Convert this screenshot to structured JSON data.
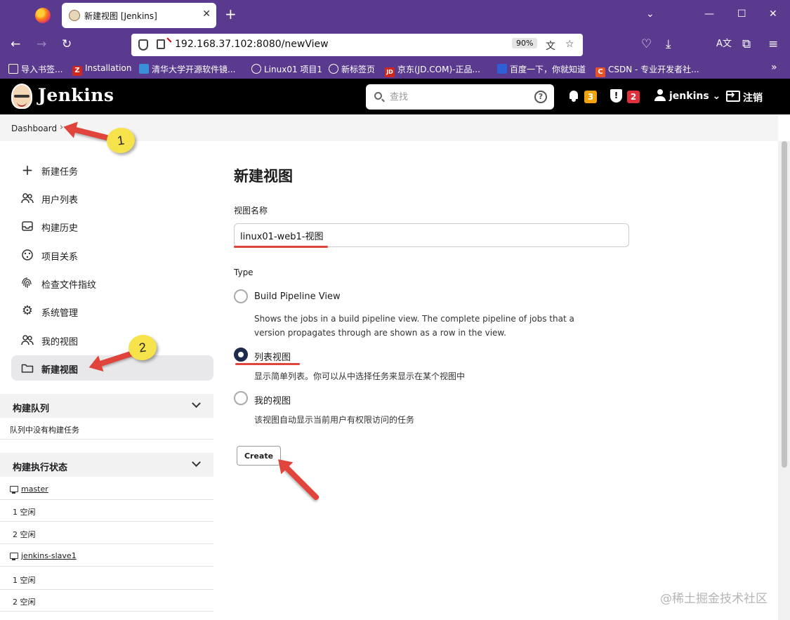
{
  "browser": {
    "tab_title": "新建视图 [Jenkins]",
    "tab_close": "✕",
    "new_tab": "+",
    "url": "192.168.37.102:8080/newView",
    "zoom": "90%",
    "bookmarks": [
      {
        "label": "导入书签...",
        "icon_color": "#5a3a8e"
      },
      {
        "label": "Installation",
        "icon_color": "#d0271d",
        "icon_text": "Z"
      },
      {
        "label": "清华大学开源软件镜...",
        "icon_color": "#3a8fd9"
      },
      {
        "label": "Linux01 项目1",
        "icon_color": "#5a3a8e"
      },
      {
        "label": "新标签页",
        "icon_color": "#5a3a8e"
      },
      {
        "label": "京东(JD.COM)-正品...",
        "icon_color": "#d0271d",
        "icon_text": "JD"
      },
      {
        "label": "百度一下，你就知道",
        "icon_color": "#2e5fd6"
      },
      {
        "label": "CSDN - 专业开发者社...",
        "icon_color": "#e8542a",
        "icon_text": "C"
      }
    ]
  },
  "jenkins": {
    "title": "Jenkins",
    "search_placeholder": "查找",
    "help": "?",
    "notifications": "3",
    "security": "2",
    "security_icon_text": "!",
    "user": "jenkins",
    "user_caret": "⌄",
    "logout": "注销",
    "colors": {
      "notify_badge": "#f0a30a",
      "security_badge": "#e0303a"
    }
  },
  "breadcrumb": {
    "item": "Dashboard",
    "sep": "›"
  },
  "sidebar": {
    "items": [
      {
        "label": "新建任务",
        "icon": "plus-icon",
        "glyph": "+"
      },
      {
        "label": "用户列表",
        "icon": "users-icon",
        "glyph": "👥"
      },
      {
        "label": "构建历史",
        "icon": "inbox-icon",
        "glyph": "▤"
      },
      {
        "label": "项目关系",
        "icon": "relationship-icon",
        "glyph": "◎"
      },
      {
        "label": "检查文件指纹",
        "icon": "fingerprint-icon",
        "glyph": "◉"
      },
      {
        "label": "系统管理",
        "icon": "gear-icon",
        "glyph": "⚙"
      },
      {
        "label": "我的视图",
        "icon": "my-views-icon",
        "glyph": "👥"
      },
      {
        "label": "新建视图",
        "icon": "folder-icon",
        "glyph": "▭"
      }
    ],
    "build_queue": {
      "title": "构建队列",
      "empty": "队列中没有构建任务"
    },
    "executors": {
      "title": "构建执行状态",
      "nodes": [
        {
          "name": "master",
          "slots": [
            "1  空闲",
            "2  空闲"
          ]
        },
        {
          "name": "jenkins-slave1",
          "slots": [
            "1  空闲",
            "2  空闲"
          ]
        }
      ]
    }
  },
  "main": {
    "title": "新建视图",
    "name_label": "视图名称",
    "name_value": "linux01-web1-视图",
    "type_label": "Type",
    "options": [
      {
        "label": "Build Pipeline View",
        "desc": "Shows the jobs in a build pipeline view. The complete pipeline of jobs that a version propagates through are shown as a row in the view.",
        "checked": false
      },
      {
        "label": "列表视图",
        "desc": "显示简单列表。你可以从中选择任务来显示在某个视图中",
        "checked": true
      },
      {
        "label": "我的视图",
        "desc": "该视图自动显示当前用户有权限访问的任务",
        "checked": false
      }
    ],
    "create_label": "Create"
  },
  "annotations": {
    "callout_1": "1",
    "callout_2": "2"
  },
  "watermark": "@稀土掘金技术社区"
}
